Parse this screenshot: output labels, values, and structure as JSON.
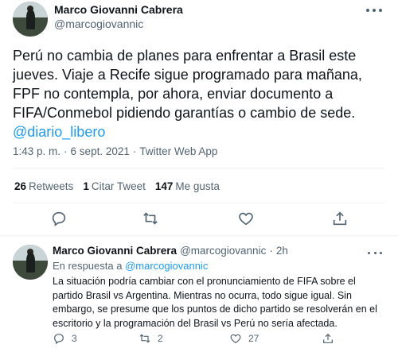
{
  "main_tweet": {
    "author_name": "Marco Giovanni Cabrera",
    "author_handle": "@marcogiovannic",
    "text_line1": "Perú no cambia de planes para enfrentar a Brasil este",
    "text_line2": "jueves. Viaje a Recife sigue programado para mañana,",
    "text_line3": "FPF no contempla, por ahora, enviar documento a",
    "text_line4": "FIFA/Conmebol pidiendo garantías o cambio de sede.",
    "mention": "@diario_libero",
    "time": "1:43 p. m.",
    "separator": "·",
    "date": "6 sept. 2021",
    "source": "Twitter Web App",
    "stats": {
      "retweets_count": "26",
      "retweets_label": "Retweets",
      "quotes_count": "1",
      "quotes_label": "Citar Tweet",
      "likes_count": "147",
      "likes_label": "Me gusta"
    },
    "icons": [
      "reply-icon",
      "retweet-icon",
      "like-icon",
      "share-icon",
      "more-icon"
    ]
  },
  "reply_tweet": {
    "author_name": "Marco Giovanni Cabrera",
    "author_handle": "@marcogiovannic",
    "separator": "·",
    "time": "2h",
    "in_reply_prefix": "En respuesta a",
    "in_reply_mention": "@marcogiovannic",
    "text_line1": "La situación podría cambiar con el pronunciamiento de FIFA sobre el",
    "text_line2": "partido Brasil vs Argentina. Mientras no ocurra, todo sigue igual. Sin",
    "text_line3": "embargo, se presume que los puntos de dicho partido se resolverán en el",
    "text_line4": "escritorio y la programación del Brasil vs Perú no sería afectada.",
    "reply_count": "3",
    "retweet_count": "2",
    "like_count": "27"
  },
  "colors": {
    "text": "#0f1419",
    "secondary": "#536471",
    "link": "#1d9bf0",
    "divider": "#eff3f4"
  }
}
